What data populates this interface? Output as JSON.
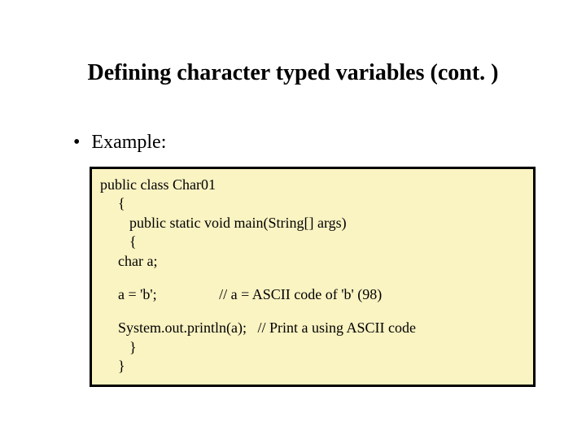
{
  "title": "Defining character typed variables (cont. )",
  "bullet": "Example:",
  "code": {
    "l1": "public class Char01",
    "l2": "{",
    "l3": "public static void main(String[] args)",
    "l4": "{",
    "l5": "char a;",
    "l6": "a = 'b';                 // a = ASCII code of 'b' (98)",
    "l7": "System.out.println(a);   // Print a using ASCII code",
    "l8": "}",
    "l9": "}"
  }
}
